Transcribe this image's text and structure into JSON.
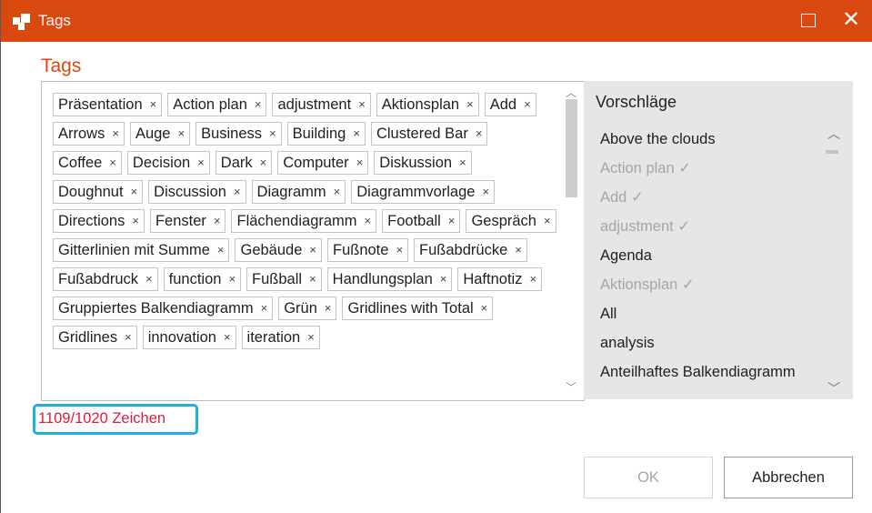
{
  "window": {
    "title": "Tags",
    "heading": "Tags",
    "accent": "#d9480f",
    "maximize_icon": "maximize-icon",
    "close_symbol": "✕"
  },
  "tags": [
    "Präsentation",
    "Action plan",
    "adjustment",
    "Aktionsplan",
    "Add",
    "Arrows",
    "Auge",
    "Business",
    "Building",
    "Clustered Bar",
    "Coffee",
    "Decision",
    "Dark",
    "Computer",
    "Diskussion",
    "Doughnut",
    "Discussion",
    "Diagramm",
    "Diagrammvorlage",
    "Directions",
    "Fenster",
    "Flächendiagramm",
    "Football",
    "Gespräch",
    "Gitterlinien mit Summe",
    "Gebäude",
    "Fußnote",
    "Fußabdrücke",
    "Fußabdruck",
    "function",
    "Fußball",
    "Handlungsplan",
    "Haftnotiz",
    "Gruppiertes Balkendiagramm",
    "Grün",
    "Gridlines with Total",
    "Gridlines",
    "innovation",
    "iteration"
  ],
  "remove_symbol": "×",
  "suggestions": {
    "title": "Vorschläge",
    "items": [
      {
        "label": "Above the clouds",
        "used": false
      },
      {
        "label": "Action plan ✓",
        "used": true
      },
      {
        "label": "Add ✓",
        "used": true
      },
      {
        "label": "adjustment ✓",
        "used": true
      },
      {
        "label": "Agenda",
        "used": false
      },
      {
        "label": "Aktionsplan ✓",
        "used": true
      },
      {
        "label": "All",
        "used": false
      },
      {
        "label": "analysis",
        "used": false
      },
      {
        "label": "Anteilhaftes Balkendiagramm",
        "used": false
      }
    ]
  },
  "counter": {
    "text": "1109/1020 Zeichen",
    "color": "#e11b3b",
    "highlight": "#1fb0e0"
  },
  "buttons": {
    "ok": "OK",
    "cancel": "Abbrechen"
  }
}
